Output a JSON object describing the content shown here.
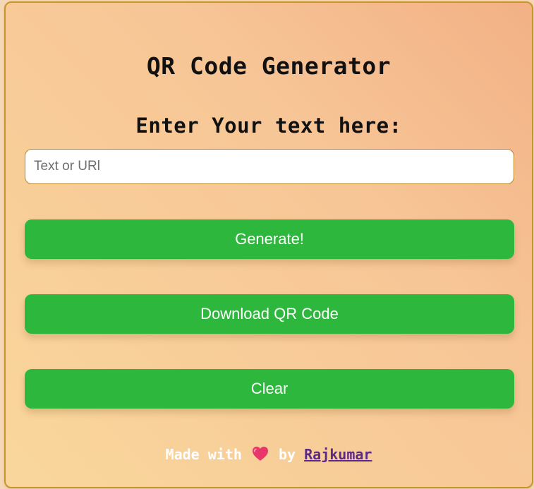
{
  "header": {
    "title": "QR Code Generator",
    "subtitle": "Enter Your text here:"
  },
  "input": {
    "placeholder": "Text or URl",
    "value": ""
  },
  "buttons": {
    "generate_label": "Generate!",
    "download_label": "Download QR Code",
    "clear_label": "Clear"
  },
  "footer": {
    "made_with": "Made with",
    "heart_icon": "heart-icon",
    "by": "by",
    "author_link": "Rajkumar"
  },
  "colors": {
    "button_bg": "#2db83d",
    "card_border": "#c79528",
    "link": "#5b2a86",
    "heart": "#e8366a"
  }
}
